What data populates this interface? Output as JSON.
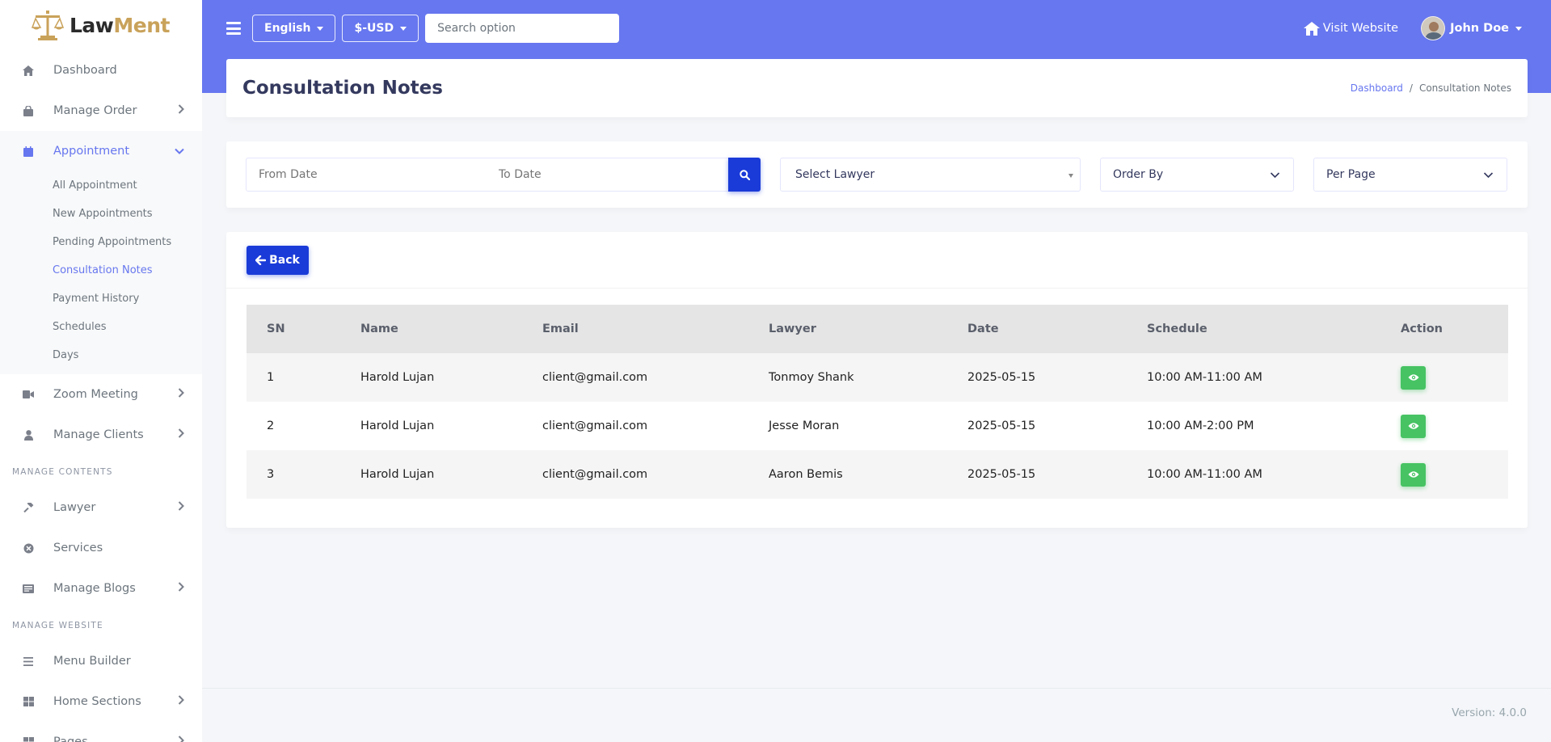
{
  "brand": {
    "name_part1": "Law",
    "name_part2": "Ment",
    "accent_color": "#c9a25a"
  },
  "sidebar": {
    "items_top": [
      {
        "label": "Dashboard",
        "icon": "home-icon"
      },
      {
        "label": "Manage Order",
        "icon": "shopping-bag-icon"
      },
      {
        "label": "Appointment",
        "icon": "calendar-icon"
      }
    ],
    "appointment_submenu": [
      {
        "label": "All Appointment"
      },
      {
        "label": "New Appointments"
      },
      {
        "label": "Pending Appointments"
      },
      {
        "label": "Consultation Notes"
      },
      {
        "label": "Payment History"
      },
      {
        "label": "Schedules"
      },
      {
        "label": "Days"
      }
    ],
    "items_mid": [
      {
        "label": "Zoom Meeting",
        "icon": "video-icon"
      },
      {
        "label": "Manage Clients",
        "icon": "user-icon"
      }
    ],
    "header_contents": "MANAGE CONTENTS",
    "items_contents": [
      {
        "label": "Lawyer",
        "icon": "gavel-icon"
      },
      {
        "label": "Services",
        "icon": "services-icon"
      },
      {
        "label": "Manage Blogs",
        "icon": "newspaper-icon"
      }
    ],
    "header_website": "MANAGE WEBSITE",
    "items_website": [
      {
        "label": "Menu Builder",
        "icon": "list-icon"
      },
      {
        "label": "Home Sections",
        "icon": "grid-icon"
      },
      {
        "label": "Pages",
        "icon": "pages-icon"
      }
    ]
  },
  "topbar": {
    "language": "English",
    "currency": "$-USD",
    "search_placeholder": "Search option",
    "visit_website": "Visit Website",
    "user_name": "John Doe",
    "color": "#6777ef"
  },
  "page": {
    "title": "Consultation Notes",
    "breadcrumb_home": "Dashboard",
    "breadcrumb_current": "Consultation Notes"
  },
  "filters": {
    "from_date_placeholder": "From Date",
    "to_date_placeholder": "To Date",
    "lawyer_select": "Select Lawyer",
    "order_by": "Order By",
    "per_page": "Per Page"
  },
  "table": {
    "back_label": "Back",
    "columns": [
      "SN",
      "Name",
      "Email",
      "Lawyer",
      "Date",
      "Schedule",
      "Action"
    ],
    "rows": [
      {
        "sn": "1",
        "name": "Harold Lujan",
        "email": "client@gmail.com",
        "lawyer": "Tonmoy Shank",
        "date": "2025-05-15",
        "schedule": "10:00 AM-11:00 AM"
      },
      {
        "sn": "2",
        "name": "Harold Lujan",
        "email": "client@gmail.com",
        "lawyer": "Jesse Moran",
        "date": "2025-05-15",
        "schedule": "10:00 AM-2:00 PM"
      },
      {
        "sn": "3",
        "name": "Harold Lujan",
        "email": "client@gmail.com",
        "lawyer": "Aaron Bemis",
        "date": "2025-05-15",
        "schedule": "10:00 AM-11:00 AM"
      }
    ]
  },
  "footer": {
    "version": "Version: 4.0.0"
  }
}
